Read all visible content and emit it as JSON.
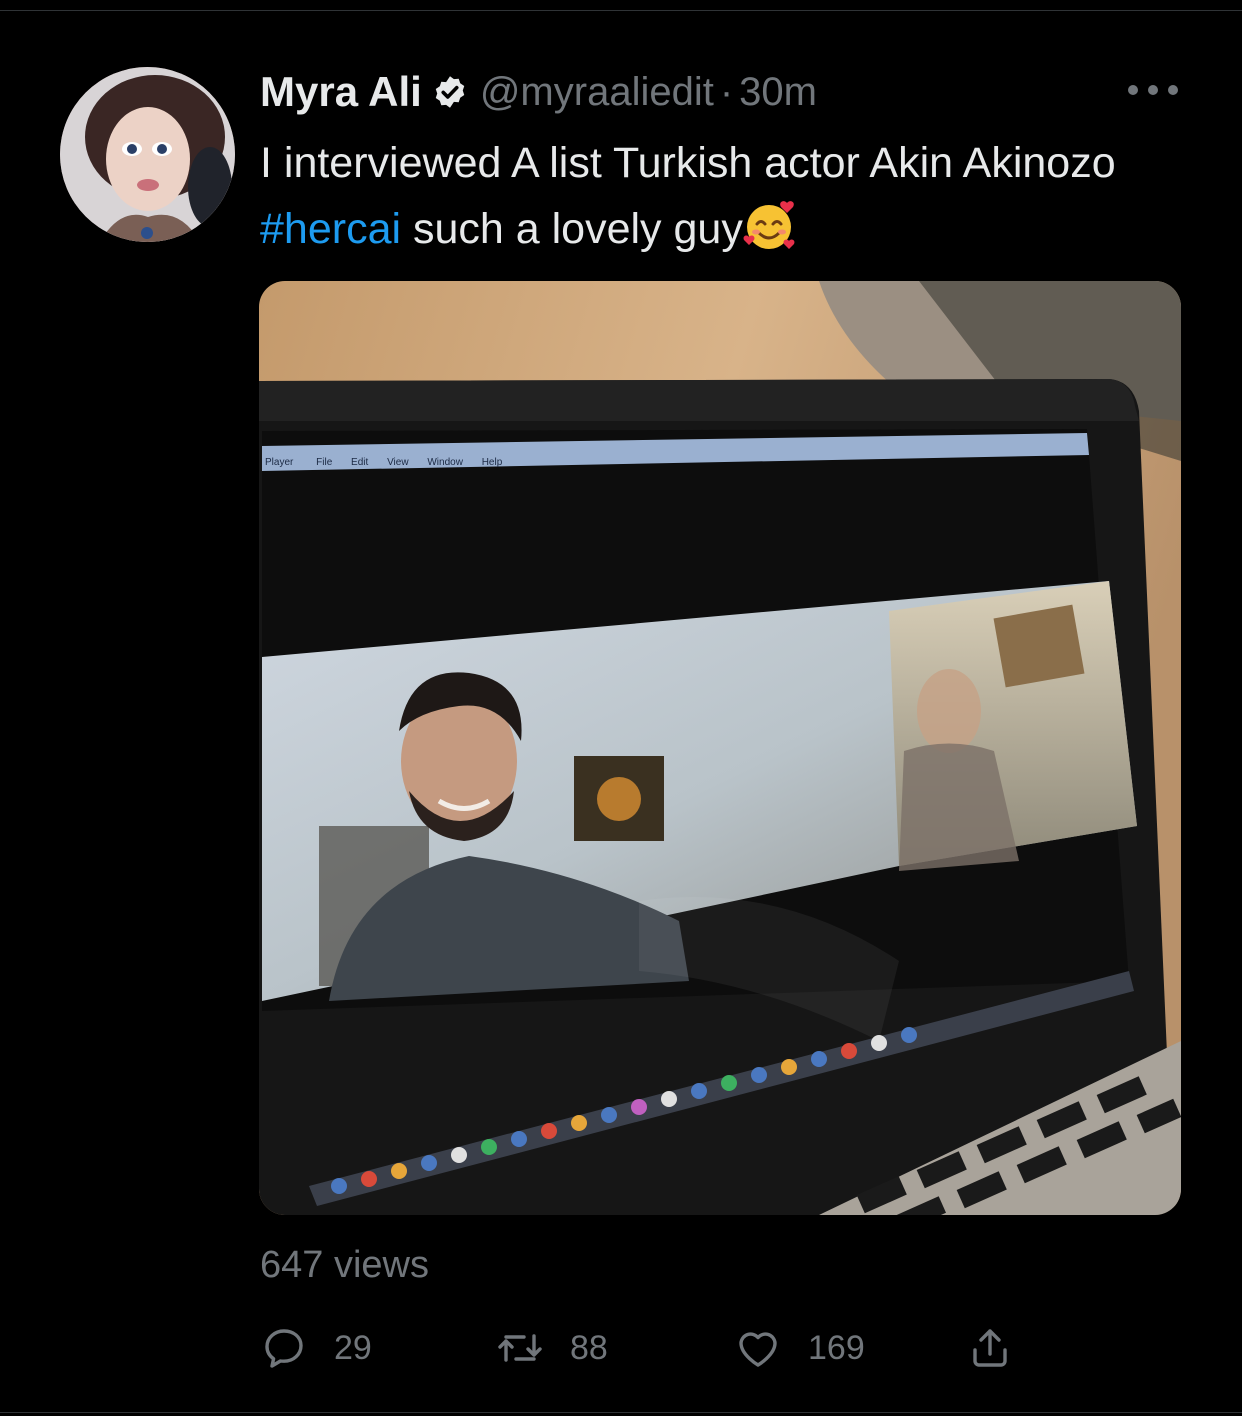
{
  "tweet": {
    "author": {
      "display_name": "Myra Ali",
      "handle": "@myraaliedit",
      "verified": true
    },
    "separator": "·",
    "timestamp": "30m",
    "text_before": "I interviewed A list Turkish actor Akin Akinozo ",
    "hashtag": "#hercai",
    "text_after": " such a lovely guy",
    "emoji": "smiling-face-with-hearts",
    "media": {
      "menu_bar": [
        "Player",
        "File",
        "Edit",
        "View",
        "Window",
        "Help"
      ]
    },
    "views": "647 views",
    "stats": {
      "replies": "29",
      "retweets": "88",
      "likes": "169"
    }
  },
  "colors": {
    "background": "#000000",
    "text": "#e7e9ea",
    "secondary": "#71767b",
    "accent": "#1d9bf0",
    "divider": "#2f3336"
  }
}
